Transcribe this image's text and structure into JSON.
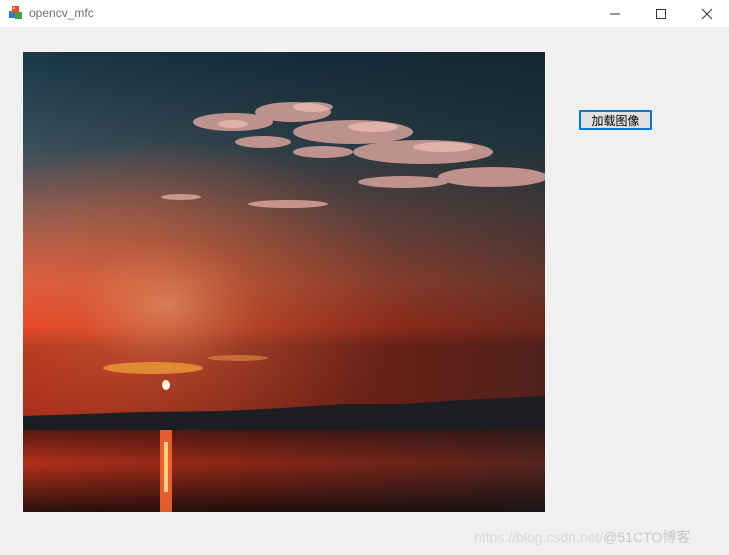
{
  "window": {
    "title": "opencv_mfc",
    "controls": [
      "minimize-icon",
      "maximize-icon",
      "close-icon"
    ]
  },
  "main": {
    "picture_icon": "sunset-photo",
    "load_button_label": "加载图像"
  },
  "watermark": {
    "url": "https://blog.csdn.net/",
    "brand": "@51CTO博客"
  },
  "colors": {
    "accent": "#0078d7",
    "window_bg": "#f0f0f0",
    "titlebar_bg": "#ffffff"
  }
}
